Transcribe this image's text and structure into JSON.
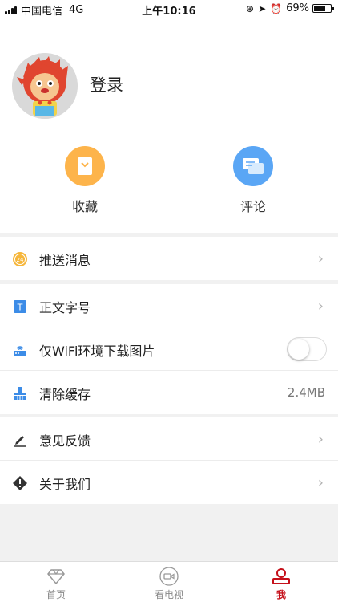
{
  "status_bar": {
    "carrier": "中国电信",
    "network": "4G",
    "time": "上午10:16",
    "battery": "69%"
  },
  "profile": {
    "login_label": "登录"
  },
  "quick_actions": [
    {
      "label": "收藏",
      "icon": "bookmark-icon",
      "color": "#fdb44b"
    },
    {
      "label": "评论",
      "icon": "comment-icon",
      "color": "#5aa6f5"
    }
  ],
  "settings": {
    "push": {
      "label": "推送消息",
      "icon_text": "24"
    },
    "font_size": {
      "label": "正文字号",
      "icon_text": "T"
    },
    "wifi_only": {
      "label": "仅WiFi环境下载图片",
      "enabled": false
    },
    "clear_cache": {
      "label": "清除缓存",
      "value": "2.4MB"
    },
    "feedback": {
      "label": "意见反馈"
    },
    "about": {
      "label": "关于我们"
    }
  },
  "tabs": [
    {
      "label": "首页",
      "icon": "diamond-icon",
      "active": false
    },
    {
      "label": "看电视",
      "icon": "video-camera-icon",
      "active": false
    },
    {
      "label": "我",
      "icon": "user-icon",
      "active": true
    }
  ],
  "colors": {
    "accent": "#c5101a",
    "background": "#f1f1f1"
  }
}
